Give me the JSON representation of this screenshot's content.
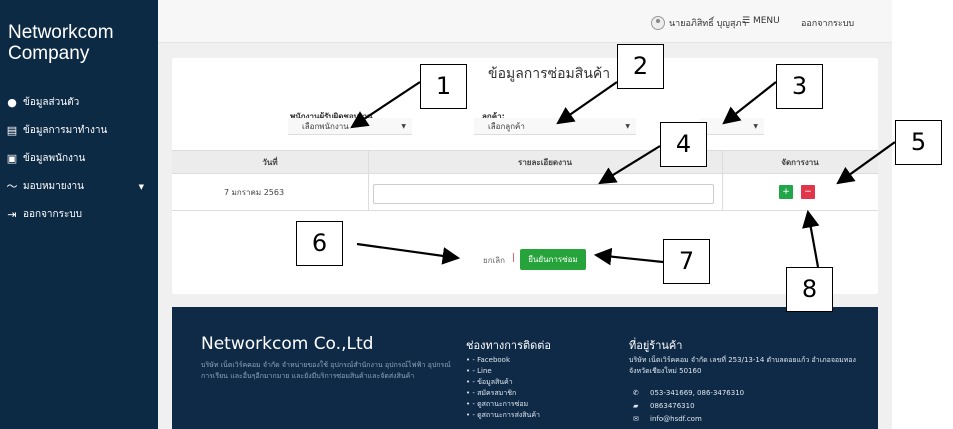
{
  "sidebar": {
    "brand_line1": "Networkcom",
    "brand_line2": "Company",
    "items": [
      {
        "icon": "user-circle-icon",
        "glyph": "●",
        "label": "ข้อมูลส่วนตัว"
      },
      {
        "icon": "document-icon",
        "glyph": "▤",
        "label": "ข้อมูลการมาทำงาน"
      },
      {
        "icon": "id-card-icon",
        "glyph": "▣",
        "label": "ข้อมูลพนักงาน"
      },
      {
        "icon": "trend-icon",
        "glyph": "〜",
        "label": "มอบหมายงาน"
      },
      {
        "icon": "sign-out-icon",
        "glyph": "⇥",
        "label": "ออกจากระบบ"
      }
    ]
  },
  "topbar": {
    "user": "นายอภิสิทธิ์ บุญสุภา",
    "menu": "MENU",
    "logout": "ออกจากระบบ"
  },
  "form": {
    "title": "ข้อมูลการซ่อมสินค้า",
    "employee_label": "พนักงานผู้รับผิดชอบงาน",
    "employee_select": "เลือกพนักงาน",
    "customer_label": "ลูกค้า:",
    "customer_select": "เลือกลูกค้า"
  },
  "table": {
    "headers": [
      "วันที่",
      "รายละเอียดงาน",
      "จัดการงาน"
    ],
    "row": {
      "date": "7 มกราคม 2563",
      "detail": ""
    }
  },
  "actions": {
    "cancel": "ยกเลิก",
    "separator": "|",
    "confirm": "ยืนยันการซ่อม",
    "add": "+",
    "delete": "−"
  },
  "footer": {
    "company": "Networkcom Co.,Ltd",
    "desc": "บริษัท เน็ตเวิร์คคอม จำกัด จำหน่ายของใช้ อุปกรณ์สำนักงาน อุปกรณ์ไฟฟ้า อุปกรณ์การเรียน และอื่นๆอีกมากมาย และยังมีบริการซ่อมสินค้าและจัดส่งสินค้า",
    "channels_title": "ช่องทางการติดต่อ",
    "channels": [
      "- Facebook",
      "- Line",
      "- ข้อมูลสินค้า",
      "- สมัครสมาชิก",
      "- ดูสถานะการซ่อม",
      "- ดูสถานะการส่งสินค้า"
    ],
    "address_title": "ที่อยู่ร้านค้า",
    "address": "บริษัท เน็ตเวิร์คคอม จำกัด เลขที่ 253/13-14 ตำบลดอยแก้ว อำเภอจอมทอง จังหวัดเชียงใหม่ 50160",
    "phone": "053-341669, 086-3476310",
    "mobile": "0863476310",
    "email": "info@hsdf.com"
  },
  "callouts": [
    "1",
    "2",
    "3",
    "4",
    "5",
    "6",
    "7",
    "8"
  ]
}
